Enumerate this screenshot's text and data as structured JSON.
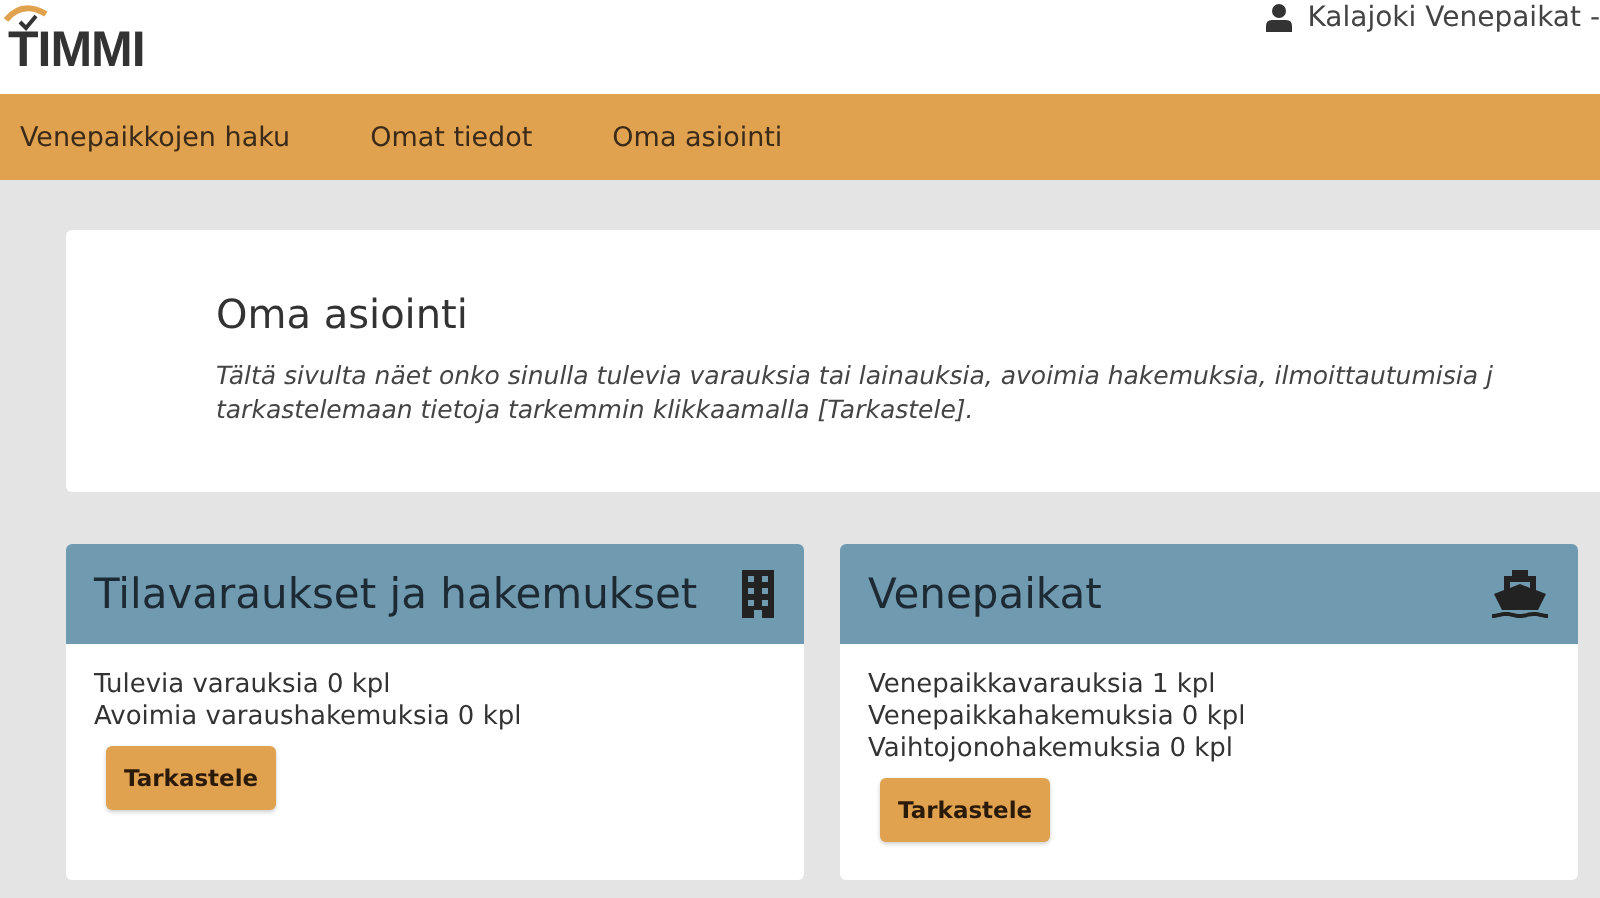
{
  "logo": "TIMMI",
  "user": {
    "name": "Kalajoki Venepaikat -"
  },
  "nav": [
    "Venepaikkojen haku",
    "Omat tiedot",
    "Oma asiointi"
  ],
  "intro": {
    "title": "Oma asiointi",
    "lines": [
      "Tältä sivulta näet onko sinulla tulevia varauksia tai lainauksia, avoimia hakemuksia, ilmoittautumisia j",
      "tarkastelemaan tietoja tarkemmin klikkaamalla [Tarkastele]."
    ]
  },
  "cards": [
    {
      "title": "Tilavaraukset ja hakemukset",
      "kind": "spaces",
      "lines": [
        "Tulevia varauksia 0 kpl",
        "Avoimia varaushakemuksia 0 kpl"
      ],
      "button": "Tarkastele"
    },
    {
      "title": "Venepaikat",
      "kind": "boats",
      "lines": [
        "Venepaikkavarauksia 1 kpl",
        "Venepaikkahakemuksia 0 kpl",
        "Vaihtojonohakemuksia 0 kpl"
      ],
      "button": "Tarkastele"
    }
  ]
}
